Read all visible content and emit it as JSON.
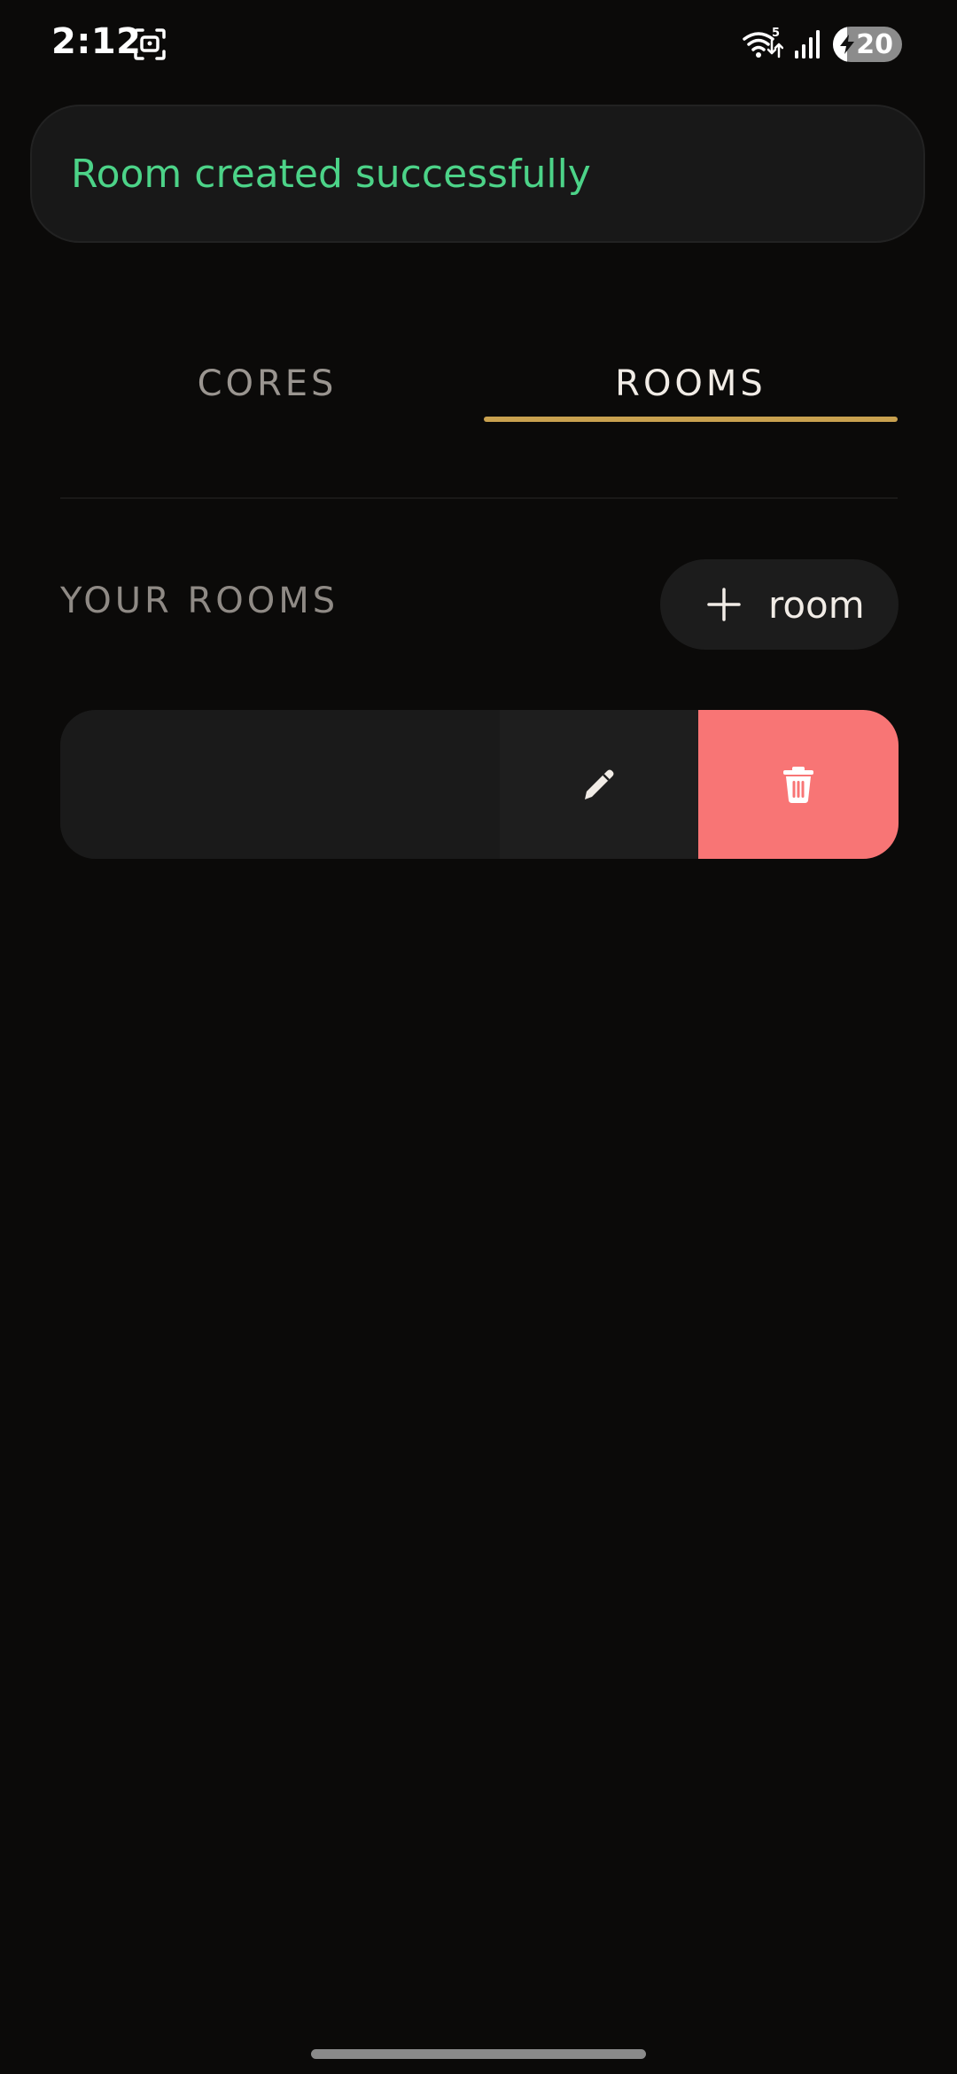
{
  "status_bar": {
    "time": "2:12",
    "battery_level": "20",
    "wifi_badge": "5",
    "icons": [
      "screenshot-icon",
      "wifi-icon",
      "signal-icon",
      "battery-icon"
    ]
  },
  "snackbar": {
    "message": "Room created successfully",
    "color": "#4cd388"
  },
  "tabs": [
    {
      "label": "CORES",
      "selected": false
    },
    {
      "label": "ROOMS",
      "selected": true
    }
  ],
  "accent_color": "#c9a14f",
  "section": {
    "title": "YOUR ROOMS",
    "add_button_label": "room",
    "add_button_icon": "plus-icon"
  },
  "room_list": [
    {
      "name": "",
      "actions": [
        {
          "icon": "pencil-icon",
          "color": "#1e1e1e"
        },
        {
          "icon": "trash-icon",
          "color": "#f87575"
        }
      ]
    }
  ]
}
